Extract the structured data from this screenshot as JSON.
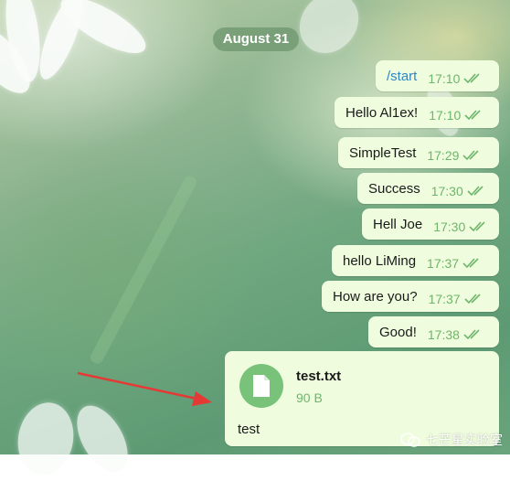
{
  "chat": {
    "date": "August 31",
    "messages": [
      {
        "text": "/start",
        "time": "17:10"
      },
      {
        "text": "Hello Al1ex!",
        "time": "17:10"
      },
      {
        "text": "SimpleTest",
        "time": "17:29"
      },
      {
        "text": "Success",
        "time": "17:30"
      },
      {
        "text": "Hell Joe",
        "time": "17:30"
      },
      {
        "text": "hello LiMing",
        "time": "17:37"
      },
      {
        "text": "How are you?",
        "time": "17:37"
      },
      {
        "text": "Good!",
        "time": "17:38"
      }
    ],
    "file": {
      "name": "test.txt",
      "size": "90 B",
      "caption": "test",
      "icon": "document-icon"
    }
  },
  "watermark": {
    "text": "七芒星实验室"
  },
  "colors": {
    "bubble": "#effdde",
    "time": "#6fb56b",
    "command": "#2f86c4",
    "file_icon_bg": "#78c27a",
    "annotation_arrow": "#e53935"
  }
}
